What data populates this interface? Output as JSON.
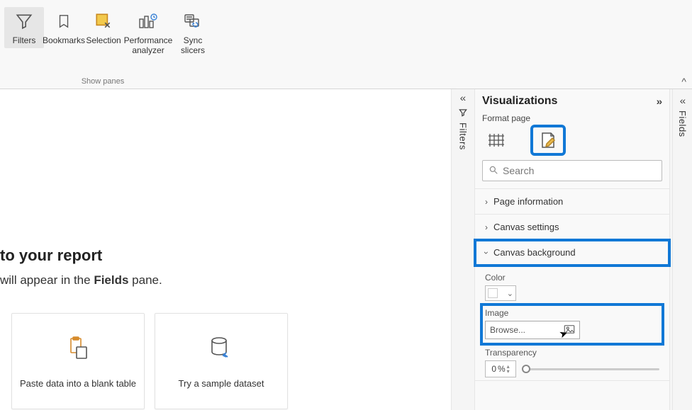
{
  "ribbon": {
    "buttons": [
      {
        "label": "Filters",
        "icon": "funnel",
        "active": true
      },
      {
        "label": "Bookmarks",
        "icon": "bookmark"
      },
      {
        "label": "Selection",
        "icon": "selection"
      },
      {
        "label": "Performance\nanalyzer",
        "icon": "perf"
      },
      {
        "label": "Sync\nslicers",
        "icon": "sync"
      }
    ],
    "group_label": "Show panes",
    "collapse": "^"
  },
  "canvas": {
    "heading": "to your report",
    "subline_prefix": "will appear in the ",
    "subline_bold": "Fields",
    "subline_suffix": " pane.",
    "cards": [
      {
        "label": "Paste data into a blank table",
        "icon": "clipboard"
      },
      {
        "label": "Try a sample dataset",
        "icon": "cylinder"
      }
    ]
  },
  "side": {
    "filters_label": "Filters",
    "fields_label": "Fields",
    "collapse_glyph": "«",
    "expand_glyph": "»"
  },
  "viz": {
    "title": "Visualizations",
    "subtitle": "Format page",
    "search_placeholder": "Search",
    "sections": {
      "page_info": "Page information",
      "canvas_settings": "Canvas settings",
      "canvas_background": "Canvas background"
    },
    "bg": {
      "color_label": "Color",
      "image_label": "Image",
      "browse_label": "Browse...",
      "transparency_label": "Transparency",
      "transparency_value": "0",
      "transparency_unit": "%"
    }
  }
}
